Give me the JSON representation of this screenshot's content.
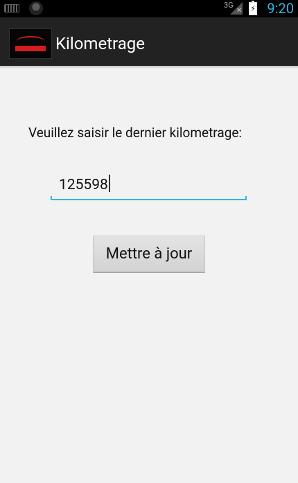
{
  "status_bar": {
    "network": "3G",
    "time": "9:20",
    "icons": [
      "keyboard-icon",
      "notification-icon",
      "signal-icon",
      "battery-charging-icon"
    ]
  },
  "action_bar": {
    "title": "Kilometrage",
    "logo_icon": "car-logo-icon"
  },
  "form": {
    "prompt": "Veuillez saisir le dernier kilometrage:",
    "km_value": "125598",
    "update_button": "Mettre à jour"
  },
  "colors": {
    "accent": "#33b5e5",
    "action_bar": "#222222",
    "background": "#f2f2f2"
  }
}
